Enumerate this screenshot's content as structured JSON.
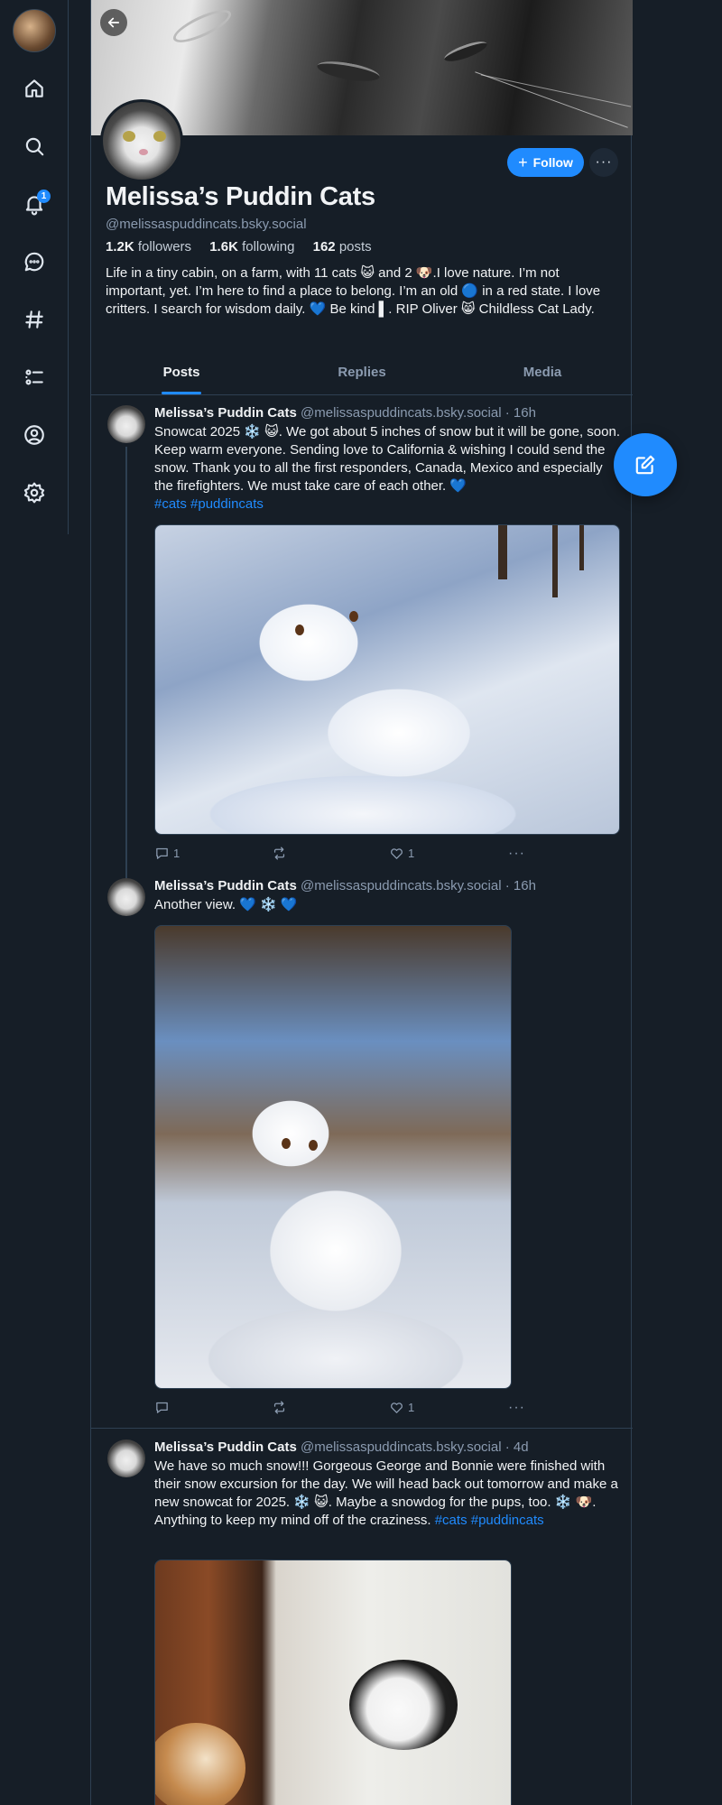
{
  "nav": {
    "items": [
      "home-icon",
      "search-icon",
      "notifications-icon",
      "chat-icon",
      "feeds-icon",
      "lists-icon",
      "profile-icon",
      "settings-icon"
    ],
    "notification_badge": "1"
  },
  "profile": {
    "display_name": "Melissa’s Puddin Cats",
    "handle": "@melissaspuddincats.bsky.social",
    "followers_count": "1.2K",
    "followers_label": "followers",
    "following_count": "1.6K",
    "following_label": "following",
    "posts_count": "162",
    "posts_label": "posts",
    "bio": "Life in a tiny cabin, on a farm, with 11 cats 😺 and 2 🐶.I love nature. I’m not important, yet. I’m here to find a place to belong. I’m an old 🔵 in a red state.  I love critters. I search for wisdom daily. 💙 Be kind ▌. RIP Oliver 😸  Childless Cat Lady.",
    "follow_label": "Follow",
    "more_label": "···"
  },
  "tabs": [
    "Posts",
    "Replies",
    "Media"
  ],
  "posts": [
    {
      "author": "Melissa’s Puddin Cats",
      "handle": "@melissaspuddincats.bsky.social",
      "time": "· 16h",
      "text": "Snowcat 2025 ❄️ 😺. We got about 5 inches of snow but it will be gone, soon. Keep warm everyone.  Sending love to California & wishing I could send the snow. Thank you to all the first responders, Canada, Mexico and especially the firefighters. We must take care of each other. 💙",
      "tags": "#cats #puddincats",
      "replies": "1",
      "reposts": "",
      "likes": "1"
    },
    {
      "author": "Melissa’s Puddin Cats",
      "handle": "@melissaspuddincats.bsky.social",
      "time": "· 16h",
      "text": "Another view. 💙 ❄️ 💙",
      "tags": "",
      "replies": "",
      "reposts": "",
      "likes": "1"
    },
    {
      "author": "Melissa’s Puddin Cats",
      "handle": "@melissaspuddincats.bsky.social",
      "time": "· 4d",
      "text": "We have so much snow!!!  Gorgeous George and Bonnie were finished with their snow excursion for the day.  We will head back out tomorrow and make a new snowcat for 2025. ❄️ 😺.  Maybe a snowdog for the pups, too. ❄️ 🐶.  Anything to keep my mind off of the craziness. ",
      "tags": "#cats #puddincats"
    }
  ],
  "colors": {
    "background": "#161e27",
    "accent": "#208bfe",
    "muted_text": "#8b9bb0",
    "border": "#2e4052"
  }
}
